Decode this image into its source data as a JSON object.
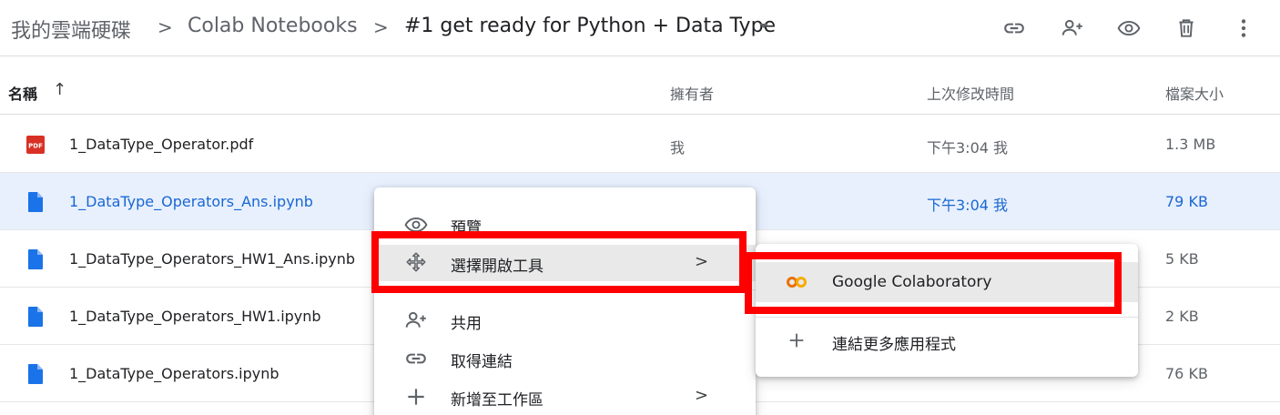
{
  "breadcrumb": {
    "root": "我的雲端硬碟",
    "folder": "Colab Notebooks",
    "current": "#1 get ready for Python + Data Type",
    "separator": ">"
  },
  "toolbar": {
    "icons": [
      "link-icon",
      "add-person-icon",
      "eye-icon",
      "trash-icon",
      "more-vert-icon"
    ]
  },
  "columns": {
    "name": "名稱",
    "sort_arrow": "↑",
    "owner": "擁有者",
    "modified": "上次修改時間",
    "size": "檔案大小"
  },
  "files": [
    {
      "name": "1_DataType_Operator.pdf",
      "type": "pdf",
      "owner": "我",
      "modified": "下午3:04 我",
      "size": "1.3 MB"
    },
    {
      "name": "1_DataType_Operators_Ans.ipynb",
      "type": "file",
      "owner": "",
      "modified": "下午3:04 我",
      "size": "79 KB",
      "selected": true
    },
    {
      "name": "1_DataType_Operators_HW1_Ans.ipynb",
      "type": "file",
      "owner": "",
      "modified": "",
      "size": "5 KB"
    },
    {
      "name": "1_DataType_Operators_HW1.ipynb",
      "type": "file",
      "owner": "",
      "modified": "",
      "size": "2 KB"
    },
    {
      "name": "1_DataType_Operators.ipynb",
      "type": "file",
      "owner": "",
      "modified": "",
      "size": "76 KB"
    }
  ],
  "pdf_badge": "PDF",
  "context_menu": {
    "items": [
      {
        "label": "預覽",
        "icon": "eye-icon"
      },
      {
        "label": "選擇開啟工具",
        "icon": "move-arrows-icon",
        "chevron": ">"
      },
      {
        "label": "共用",
        "icon": "add-person-icon"
      },
      {
        "label": "取得連結",
        "icon": "link-icon"
      },
      {
        "label": "新增至工作區",
        "icon": "plus-icon",
        "chevron": ">"
      }
    ]
  },
  "submenu": {
    "items": [
      {
        "label": "Google Colaboratory",
        "icon": "colab-icon"
      },
      {
        "label": "連結更多應用程式",
        "icon": "plus-icon"
      }
    ]
  },
  "colors": {
    "highlight": "#ff0000",
    "selected_row": "#e8f0fe",
    "selected_text": "#1967d2",
    "file_icon": "#1a73e8",
    "pdf_icon": "#d93025",
    "colab_orange": "#f9ab00"
  }
}
